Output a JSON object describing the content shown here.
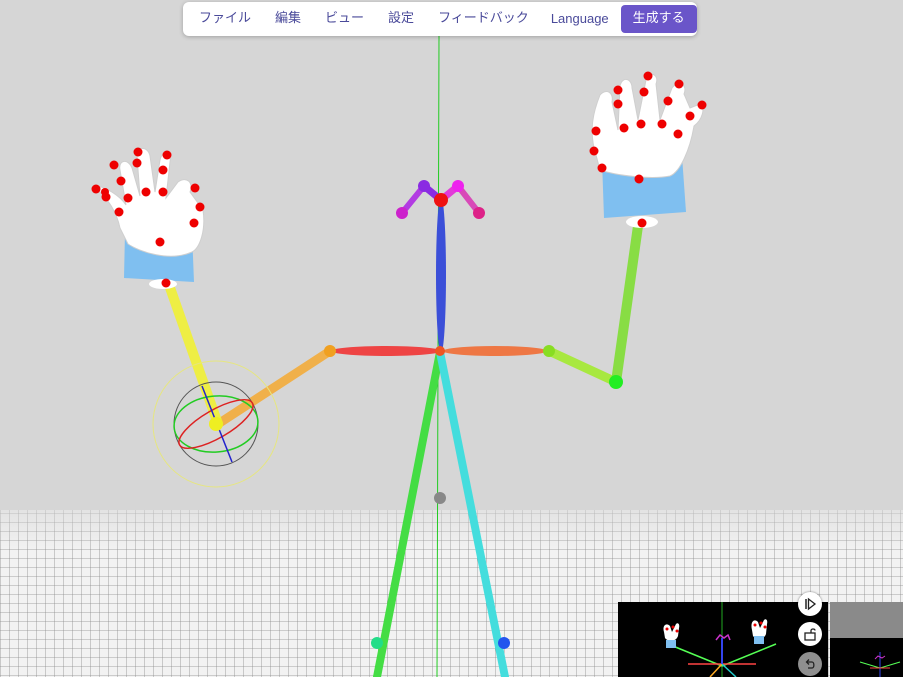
{
  "menu": {
    "items": [
      {
        "label": "ファイル"
      },
      {
        "label": "編集"
      },
      {
        "label": "ビュー"
      },
      {
        "label": "設定"
      },
      {
        "label": "フィードバック"
      },
      {
        "label": "Language"
      }
    ],
    "generate_label": "生成する"
  },
  "colors": {
    "background": "#d6d6d6",
    "accent": "#6a55c9",
    "menu_text": "#4a4a9a",
    "joint_red": "#ff0000",
    "hand_white": "#ffffff",
    "wrist_blue": "#7fbff0"
  },
  "icons": {
    "play_step": "play-step-icon",
    "lock": "lock-icon",
    "undo": "undo-icon"
  }
}
